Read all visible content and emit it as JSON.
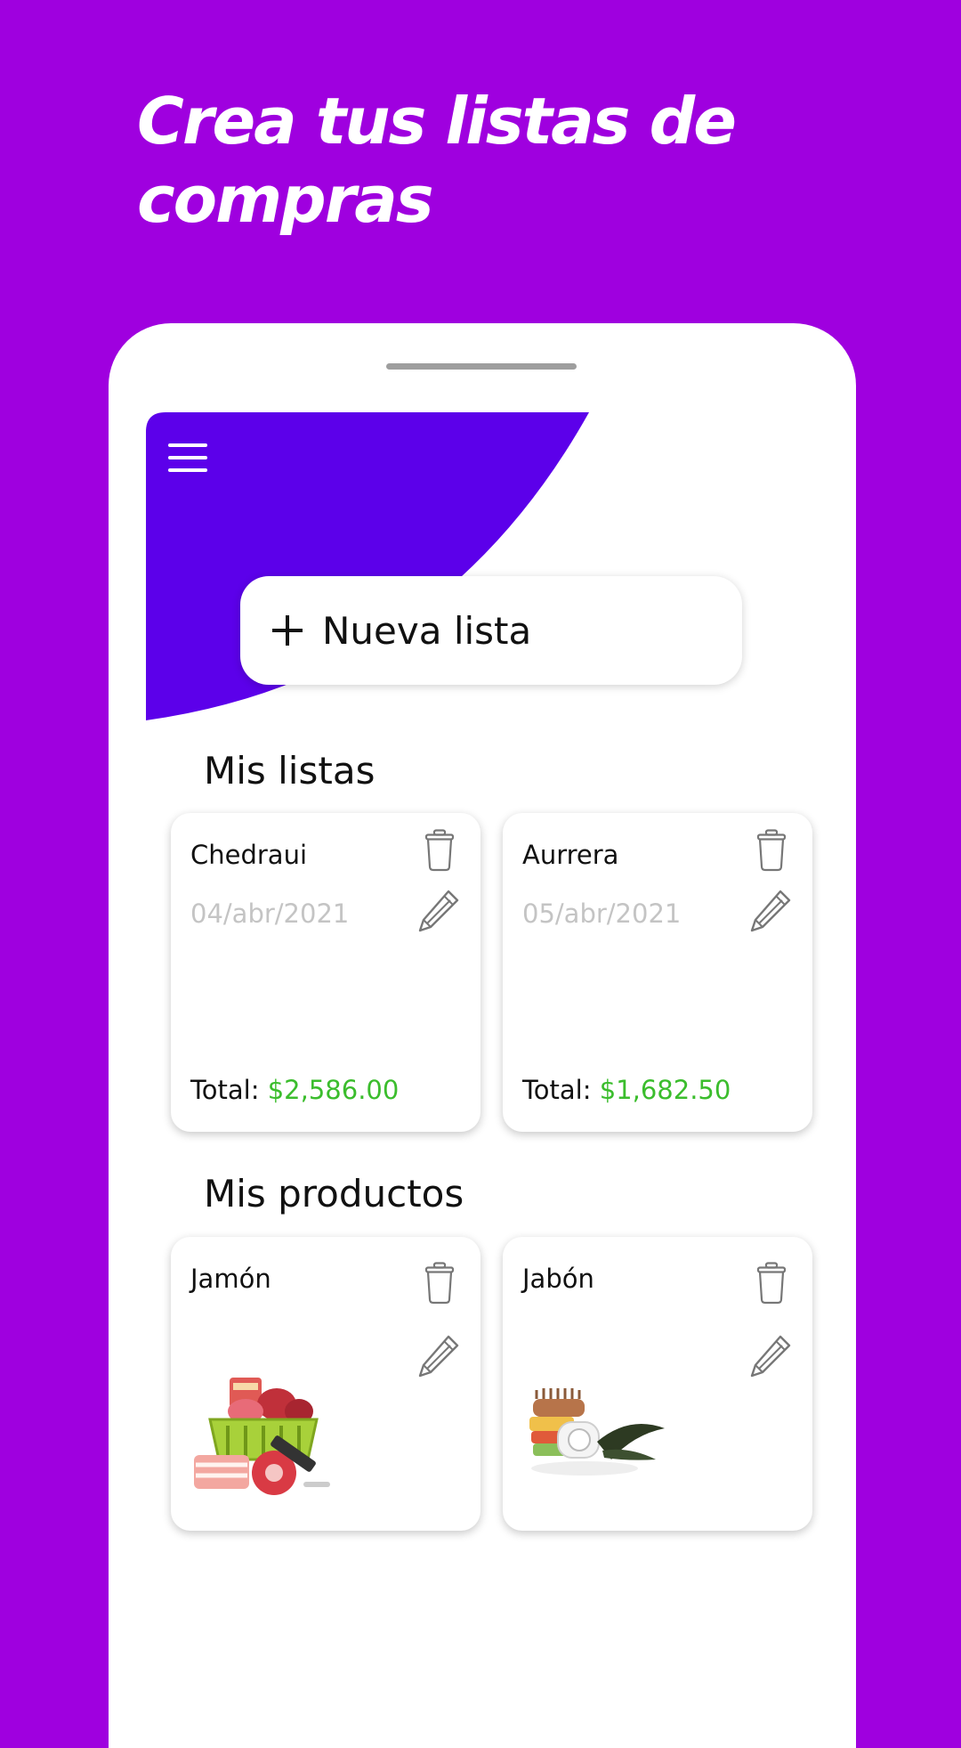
{
  "headline": "Crea tus listas de compras",
  "colors": {
    "background": "#9f00df",
    "header": "#5c00ea",
    "amount": "#3bbd2d",
    "date": "#c4c4c4"
  },
  "actions": {
    "new_list": "Nueva lista"
  },
  "sections": {
    "lists_title": "Mis listas",
    "products_title": "Mis productos"
  },
  "total_label": "Total:",
  "lists": [
    {
      "name": "Chedraui",
      "date": "04/abr/2021",
      "total": "$2,586.00"
    },
    {
      "name": "Aurrera",
      "date": "05/abr/2021",
      "total": "$1,682.50"
    }
  ],
  "products": [
    {
      "name": "Jamón",
      "image": "meat-basket-image"
    },
    {
      "name": "Jabón",
      "image": "soap-brush-towel-image"
    }
  ],
  "icons": [
    "menu-icon",
    "plus-icon",
    "trash-icon",
    "pencil-icon"
  ]
}
